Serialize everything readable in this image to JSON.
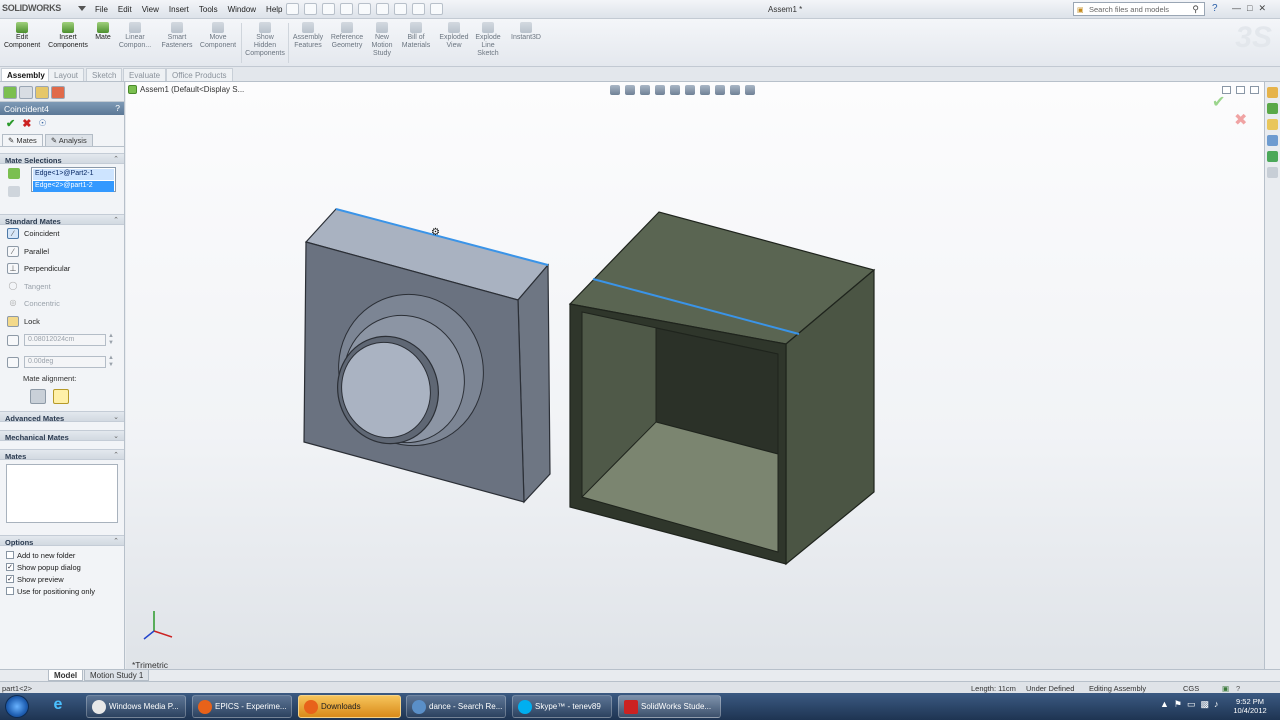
{
  "app": {
    "logo_text": "SOLIDWORKS",
    "title": "Assem1 *",
    "menu": [
      "File",
      "Edit",
      "View",
      "Insert",
      "Tools",
      "Window",
      "Help"
    ],
    "search_placeholder": "Search files and models"
  },
  "command_manager": {
    "commands": [
      {
        "label": "Edit\nComponent"
      },
      {
        "label": "Insert\nComponents"
      },
      {
        "label": "Mate"
      },
      {
        "label": "Linear\nCompon..."
      },
      {
        "label": "Smart\nFasteners"
      },
      {
        "label": "Move\nComponent"
      },
      {
        "label": "Show\nHidden\nComponents"
      },
      {
        "label": "Assembly\nFeatures"
      },
      {
        "label": "Reference\nGeometry"
      },
      {
        "label": "New\nMotion\nStudy"
      },
      {
        "label": "Bill of\nMaterials"
      },
      {
        "label": "Exploded\nView"
      },
      {
        "label": "Explode\nLine\nSketch"
      },
      {
        "label": "Instant3D"
      }
    ],
    "tabs": [
      "Assembly",
      "Layout",
      "Sketch",
      "Evaluate",
      "Office Products"
    ]
  },
  "property_manager": {
    "title": "Coincident4",
    "subtabs": [
      "Mates",
      "Analysis"
    ],
    "mate_selections_header": "Mate Selections",
    "selections": [
      "Edge<1>@Part2-1",
      "Edge<2>@part1-2"
    ],
    "standard_mates_header": "Standard Mates",
    "standard_mates": [
      {
        "label": "Coincident",
        "enabled": true
      },
      {
        "label": "Parallel",
        "enabled": true
      },
      {
        "label": "Perpendicular",
        "enabled": true
      },
      {
        "label": "Tangent",
        "enabled": false
      },
      {
        "label": "Concentric",
        "enabled": false
      },
      {
        "label": "Lock",
        "enabled": true
      }
    ],
    "distance_value": "0.08012024cm",
    "angle_value": "0.00deg",
    "mate_alignment_label": "Mate alignment:",
    "advanced_mates_header": "Advanced Mates",
    "mechanical_mates_header": "Mechanical Mates",
    "mates_header": "Mates",
    "options_header": "Options",
    "options": [
      {
        "label": "Add to new folder",
        "checked": false
      },
      {
        "label": "Show popup dialog",
        "checked": true
      },
      {
        "label": "Show preview",
        "checked": true
      },
      {
        "label": "Use for positioning only",
        "checked": false
      }
    ]
  },
  "graphics": {
    "tree_label": "Assem1 (Default<Display S...",
    "view_orientation": "*Trimetric"
  },
  "bottom_tabs": [
    "Model",
    "Motion Study 1"
  ],
  "status": {
    "left": "part1<2>",
    "length": "Length: 11cm",
    "state": "Under Defined",
    "mode": "Editing Assembly",
    "units": "CGS"
  },
  "taskbar": {
    "items": [
      {
        "label": "Windows Media P...",
        "color": "#e8e8e8"
      },
      {
        "label": "EPICS - Experime...",
        "color": "#e8621a"
      },
      {
        "label": "Downloads",
        "color": "#e8621a"
      },
      {
        "label": "dance - Search Re...",
        "color": "#5a8fc8"
      },
      {
        "label": "Skype™ - tenev89",
        "color": "#00aff0"
      },
      {
        "label": "SolidWorks Stude...",
        "color": "#cc2222"
      }
    ],
    "time": "9:52 PM",
    "date": "10/4/2012"
  }
}
